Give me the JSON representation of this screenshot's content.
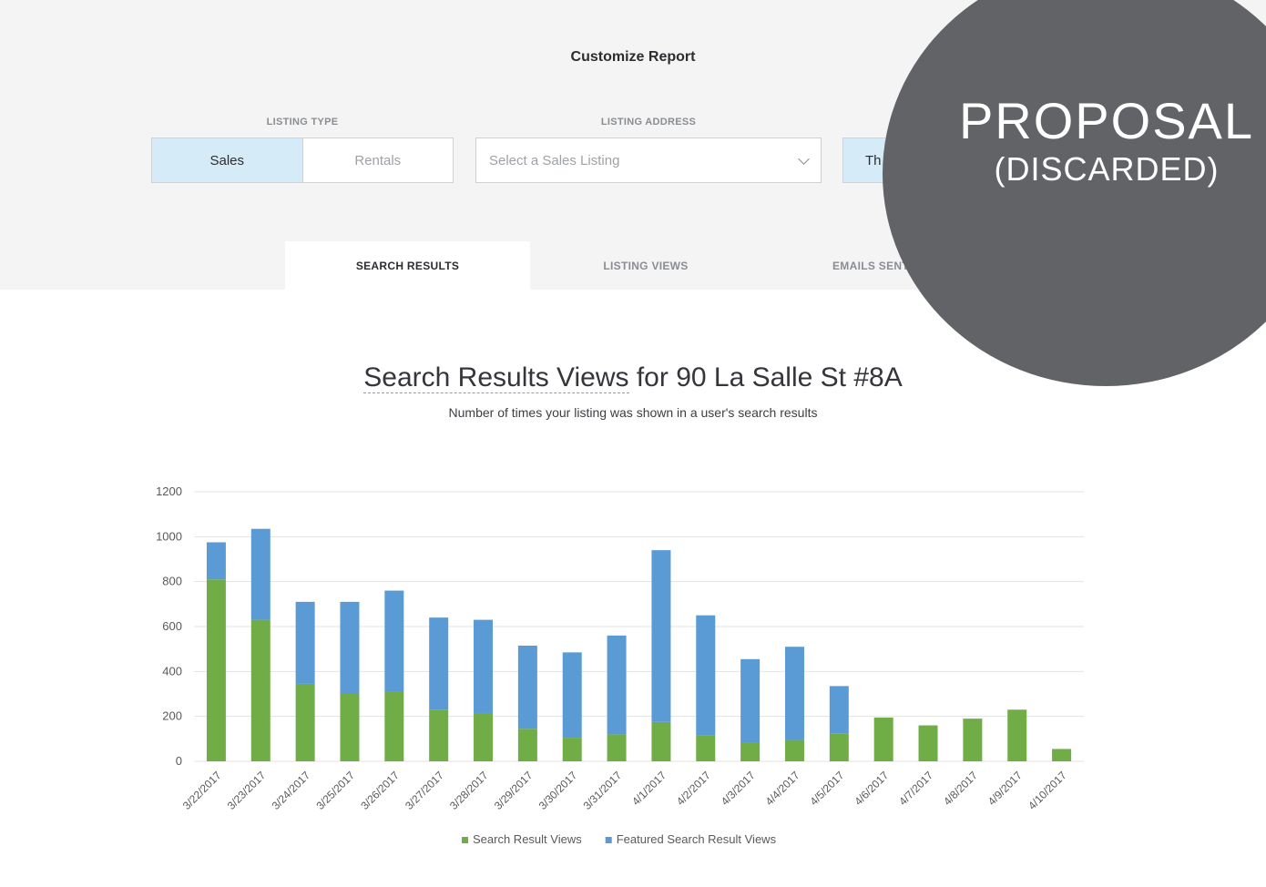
{
  "report": {
    "title": "Customize Report",
    "listing_type_label": "LISTING TYPE",
    "listing_address_label": "LISTING ADDRESS",
    "listing_type_options": [
      "Sales",
      "Rentals"
    ],
    "listing_type_selected": "Sales",
    "address_placeholder": "Select a Sales Listing",
    "date_range_visible": "Th"
  },
  "tabs": [
    {
      "label": "SEARCH RESULTS",
      "active": true
    },
    {
      "label": "LISTING VIEWS",
      "active": false
    },
    {
      "label": "EMAILS SENT",
      "active": false
    }
  ],
  "chart_header": {
    "title_prefix": "Search Results Views",
    "title_suffix": " for 90 La Salle St #8A",
    "subtitle": "Number of times your listing was shown in a user's search results"
  },
  "stamp": {
    "line1": "PROPOSAL",
    "line2": "(DISCARDED)"
  },
  "colors": {
    "accent_blue": "#5b9bd5",
    "accent_green": "#70ad47",
    "active_tab_bg": "#d6ebf8",
    "badge": "#626367"
  },
  "chart_data": {
    "type": "bar",
    "stacked": true,
    "categories": [
      "3/22/2017",
      "3/23/2017",
      "3/24/2017",
      "3/25/2017",
      "3/26/2017",
      "3/27/2017",
      "3/28/2017",
      "3/29/2017",
      "3/30/2017",
      "3/31/2017",
      "4/1/2017",
      "4/2/2017",
      "4/3/2017",
      "4/4/2017",
      "4/5/2017",
      "4/6/2017",
      "4/7/2017",
      "4/8/2017",
      "4/9/2017",
      "4/10/2017"
    ],
    "series": [
      {
        "name": "Search Result Views",
        "color": "#70ad47",
        "values": [
          810,
          630,
          345,
          300,
          310,
          230,
          215,
          145,
          105,
          120,
          175,
          115,
          85,
          95,
          125,
          195,
          160,
          190,
          230,
          55
        ]
      },
      {
        "name": "Featured Search Result Views",
        "color": "#5b9bd5",
        "values": [
          165,
          405,
          365,
          410,
          450,
          410,
          415,
          370,
          380,
          440,
          765,
          535,
          370,
          415,
          210,
          0,
          0,
          0,
          0,
          0
        ]
      }
    ],
    "ylim": [
      0,
      1200
    ],
    "yticks": [
      0,
      200,
      400,
      600,
      800,
      1000,
      1200
    ],
    "grid": true,
    "legend": "bottom"
  }
}
